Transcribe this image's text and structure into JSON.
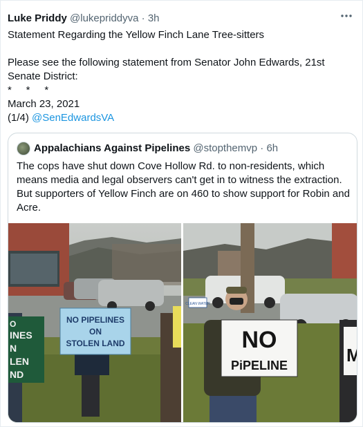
{
  "tweet": {
    "author_name": "Luke Priddy",
    "author_handle": "@lukepriddyva",
    "separator": "·",
    "time": "3h",
    "more_icon": "more-icon",
    "lines": [
      "Statement Regarding the Yellow Finch Lane Tree-sitters",
      "",
      "Please see the following statement from Senator John Edwards, 21st Senate District:",
      "*     *     *",
      "March 23, 2021"
    ],
    "thread_prefix": "(1/4) ",
    "mention": "@SenEdwardsVA"
  },
  "quoted_tweet": {
    "author_name": "Appalachians Against Pipelines",
    "author_handle": "@stopthemvp",
    "separator": "·",
    "time": "6h",
    "text": "The cops have shut down Cove Hollow Rd. to non-residents, which means media and legal observers can't get in to witness the extraction. But supporters of Yellow Finch are on 460 to show support for Robin and Acre.",
    "photos": {
      "left_signs": [
        "NO PIPELINES",
        "ON",
        "STOLEN LAND"
      ],
      "left_partial_sign": [
        "O",
        "INES",
        "N",
        "LEN",
        "ND"
      ],
      "right_sign": [
        "NO",
        "PiPELINE"
      ],
      "right_partial_sign": "M",
      "clean_water_sign": "CLEAN WATER"
    }
  },
  "colors": {
    "link": "#1b95e0",
    "secondary_text": "#536471",
    "border": "#cfd9de"
  }
}
